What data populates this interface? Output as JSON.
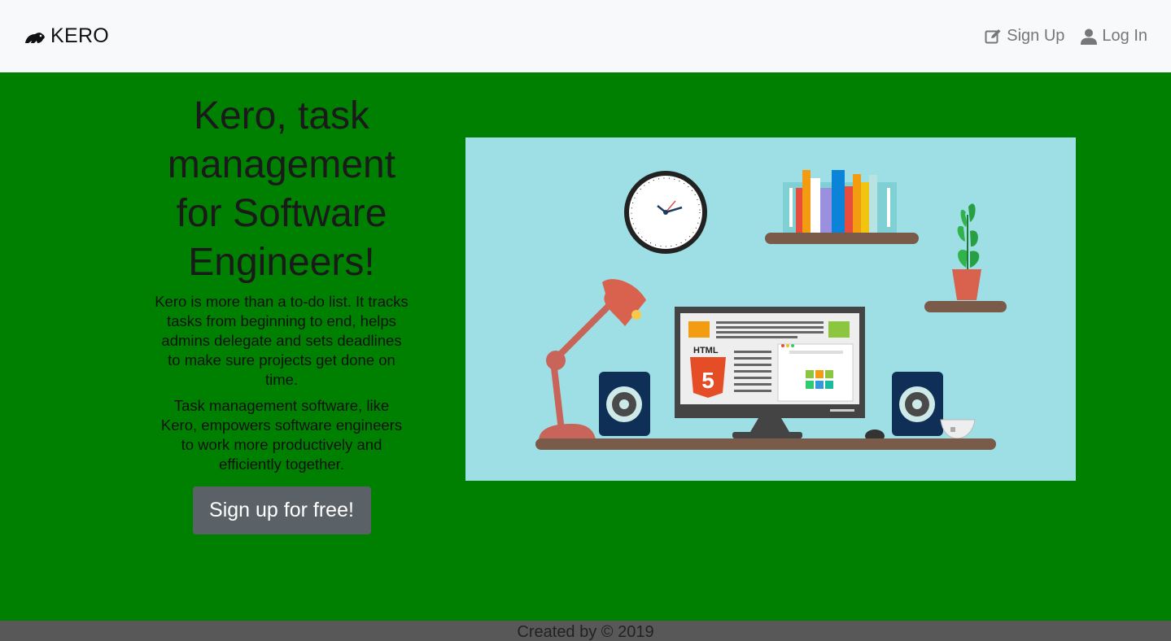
{
  "navbar": {
    "brand": "KERO",
    "brand_icon": "kero-frog-icon",
    "links": [
      {
        "label": "Sign Up",
        "icon": "edit-icon"
      },
      {
        "label": "Log In",
        "icon": "user-icon"
      }
    ]
  },
  "hero": {
    "title": "Kero, task management for Software Engineers!",
    "paragraph_1": "Kero is more than a to-do list. It tracks tasks from beginning to end, helps admins delegate and sets deadlines to make sure projects get done on time.",
    "paragraph_2": "Task management software, like Kero, empowers software engineers to work more productively and efficiently together.",
    "cta_label": "Sign up for free!"
  },
  "illustration": {
    "screen_badge": "HTML",
    "screen_number": "5"
  },
  "footer": {
    "text": "Created by © 2019"
  },
  "colors": {
    "page_background": "#008000",
    "navbar_background": "#f8f9fa",
    "cta_background": "#5a6268",
    "footer_background": "#585858",
    "illustration_background": "#9ddfe4"
  }
}
